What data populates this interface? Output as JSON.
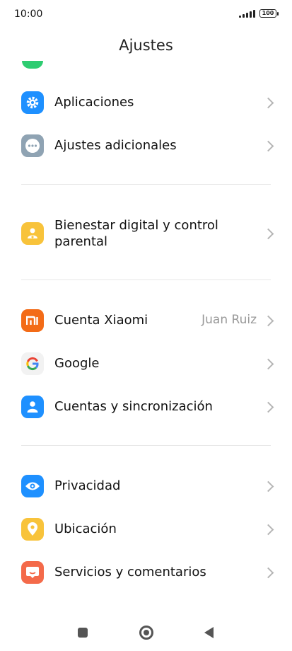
{
  "status": {
    "time": "10:00",
    "battery": "100"
  },
  "header": {
    "title": "Ajustes"
  },
  "items": [
    {
      "label": "Aplicaciones",
      "icon": "gear-icon",
      "color": "#1e90ff"
    },
    {
      "label": "Ajustes adicionales",
      "icon": "more-dots-icon",
      "color": "#8fa3b3"
    },
    {
      "label_line1": "Bienestar digital y control",
      "label_line2": "parental",
      "icon": "wellbeing-icon",
      "color": "#f8c33b"
    },
    {
      "label": "Cuenta Xiaomi",
      "value": "Juan Ruiz",
      "icon": "xiaomi-logo-icon",
      "color": "#f36b17"
    },
    {
      "label": "Google",
      "icon": "google-logo-icon",
      "color": "#f2f2f2"
    },
    {
      "label": "Cuentas y sincronización",
      "icon": "account-icon",
      "color": "#1e90ff"
    },
    {
      "label": "Privacidad",
      "icon": "eye-icon",
      "color": "#1e90ff"
    },
    {
      "label": "Ubicación",
      "icon": "location-pin-icon",
      "color": "#f8c33b"
    },
    {
      "label": "Servicios y comentarios",
      "icon": "feedback-icon",
      "color": "#f46a4a"
    }
  ]
}
